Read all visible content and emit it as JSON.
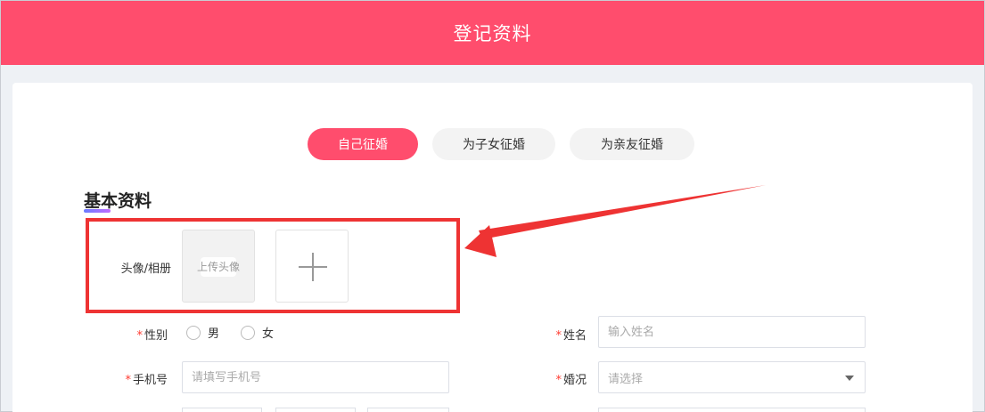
{
  "header": {
    "title": "登记资料"
  },
  "tabs": [
    {
      "label": "自己征婚",
      "active": true
    },
    {
      "label": "为子女征婚",
      "active": false
    },
    {
      "label": "为亲友征婚",
      "active": false
    }
  ],
  "section": {
    "title": "基本资料"
  },
  "avatar": {
    "label": "头像/相册",
    "upload_text": "上传头像"
  },
  "gender": {
    "label": "性别",
    "required_mark": "*",
    "options": [
      "男",
      "女"
    ]
  },
  "name": {
    "label": "姓名",
    "required_mark": "*",
    "placeholder": "输入姓名"
  },
  "phone": {
    "label": "手机号",
    "required_mark": "*",
    "placeholder": "请填写手机号"
  },
  "marital": {
    "label": "婚况",
    "required_mark": "*",
    "placeholder": "请选择"
  },
  "colors": {
    "brand": "#ff4d6d",
    "annotation": "#ee3333"
  }
}
